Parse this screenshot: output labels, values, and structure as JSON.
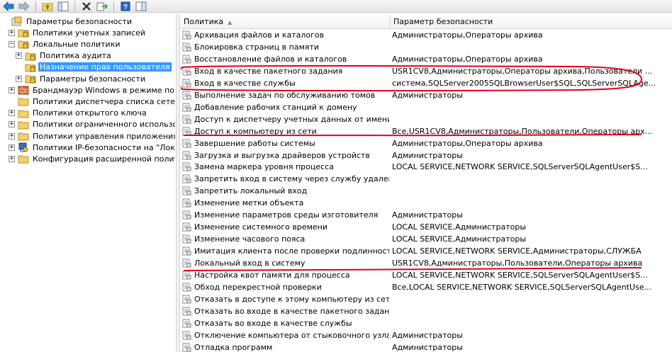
{
  "toolbar": {
    "buttons": [
      {
        "name": "back-button",
        "icon": "arrow-left-icon"
      },
      {
        "name": "forward-button",
        "icon": "arrow-right-icon"
      },
      {
        "name": "up-level-button",
        "icon": "folder-up-icon"
      },
      {
        "name": "show-hide-tree-button",
        "icon": "console-tree-icon"
      },
      {
        "name": "delete-button",
        "icon": "delete-x-icon"
      },
      {
        "name": "export-list-button",
        "icon": "export-icon"
      },
      {
        "name": "help-button",
        "icon": "help-icon"
      },
      {
        "name": "show-hide-action-pane-button",
        "icon": "action-pane-icon"
      }
    ]
  },
  "tree": {
    "items": [
      {
        "label": "Параметры безопасности",
        "level": 0,
        "expander": "",
        "icon": "security-settings-icon",
        "selected": false
      },
      {
        "label": "Политики учетных записей",
        "level": 1,
        "expander": "+",
        "icon": "folder-icon",
        "selected": false
      },
      {
        "label": "Локальные политики",
        "level": 1,
        "expander": "-",
        "icon": "folder-icon",
        "selected": false
      },
      {
        "label": "Политика аудита",
        "level": 2,
        "expander": "+",
        "icon": "folder-icon",
        "selected": false
      },
      {
        "label": "Назначение прав пользователя",
        "level": 2,
        "expander": "",
        "icon": "folder-icon",
        "selected": true
      },
      {
        "label": "Параметры безопасности",
        "level": 2,
        "expander": "+",
        "icon": "folder-icon",
        "selected": false
      },
      {
        "label": "Брандмауэр Windows в режиме повыше",
        "level": 1,
        "expander": "+",
        "icon": "firewall-icon",
        "selected": false
      },
      {
        "label": "Политики диспетчера списка сетей",
        "level": 1,
        "expander": "",
        "icon": "folder-icon",
        "selected": false
      },
      {
        "label": "Политики открытого ключа",
        "level": 1,
        "expander": "+",
        "icon": "folder-icon",
        "selected": false
      },
      {
        "label": "Политики ограниченного использовани",
        "level": 1,
        "expander": "+",
        "icon": "folder-icon",
        "selected": false
      },
      {
        "label": "Политики управления приложениями",
        "level": 1,
        "expander": "+",
        "icon": "folder-icon",
        "selected": false
      },
      {
        "label": "Политики IP-безопасности на \"Локальн",
        "level": 1,
        "expander": "+",
        "icon": "ip-security-icon",
        "selected": false
      },
      {
        "label": "Конфигурация расширенной политики",
        "level": 1,
        "expander": "+",
        "icon": "folder-icon",
        "selected": false
      }
    ]
  },
  "list": {
    "columns": [
      "Политика",
      "Параметр безопасности"
    ],
    "rows": [
      {
        "policy": "Архивация файлов и каталогов",
        "value": "Администраторы,Операторы архива"
      },
      {
        "policy": "Блокировка страниц в памяти",
        "value": ""
      },
      {
        "policy": "Восстановление файлов и каталогов",
        "value": "Администраторы,Операторы архива"
      },
      {
        "policy": "Вход в качестве пакетного задания",
        "value": "USR1CV8,Администраторы,Операторы архива,Пользователи ..."
      },
      {
        "policy": "Вход в качестве службы",
        "value": "система,SQLServer2005SQLBrowserUser$SQL,SQLServerSQLAge..."
      },
      {
        "policy": "Выполнение задач по обслуживанию томов",
        "value": "Администраторы"
      },
      {
        "policy": "Добавление рабочих станций к домену",
        "value": ""
      },
      {
        "policy": "Доступ к диспетчеру учетных данных от имени д...",
        "value": ""
      },
      {
        "policy": "Доступ к компьютеру из сети",
        "value": "Все,USR1CV8,Администраторы,Пользователи,Операторы арх..."
      },
      {
        "policy": "Завершение работы системы",
        "value": "Администраторы,Операторы архива"
      },
      {
        "policy": "Загрузка и выгрузка драйверов устройств",
        "value": "Администраторы"
      },
      {
        "policy": "Замена маркера уровня процесса",
        "value": "LOCAL SERVICE,NETWORK SERVICE,SQLServerSQLAgentUser$S..."
      },
      {
        "policy": "Запретить вход в систему через службу удаленно...",
        "value": ""
      },
      {
        "policy": "Запретить локальный вход",
        "value": ""
      },
      {
        "policy": "Изменение метки объекта",
        "value": ""
      },
      {
        "policy": "Изменение параметров среды изготовителя",
        "value": "Администраторы"
      },
      {
        "policy": "Изменение системного времени",
        "value": "LOCAL SERVICE,Администраторы"
      },
      {
        "policy": "Изменение часового пояса",
        "value": "LOCAL SERVICE,Администраторы"
      },
      {
        "policy": "Имитация клиента после проверки подлинности",
        "value": "LOCAL SERVICE,NETWORK SERVICE,Администраторы,СЛУЖБА"
      },
      {
        "policy": "Локальный вход в систему",
        "value": "USR1CV8,Администраторы,Пользователи,Операторы архива"
      },
      {
        "policy": "Настройка квот памяти для процесса",
        "value": "LOCAL SERVICE,NETWORK SERVICE,SQLServerSQLAgentUser$S..."
      },
      {
        "policy": "Обход перекрестной проверки",
        "value": "Все,LOCAL SERVICE,NETWORK SERVICE,SQLServerSQLAgentUse..."
      },
      {
        "policy": "Отказать в доступе к этому компьютеру из сети",
        "value": ""
      },
      {
        "policy": "Отказать во входе в качестве пакетного задания",
        "value": ""
      },
      {
        "policy": "Отказать во входе в качестве службы",
        "value": ""
      },
      {
        "policy": "Отключение компьютера от стыковочного узла",
        "value": "Администраторы"
      },
      {
        "policy": "Отладка программ",
        "value": "Администраторы"
      }
    ]
  },
  "colors": {
    "selection": "#3399ff",
    "annotation": "#e0001b"
  }
}
